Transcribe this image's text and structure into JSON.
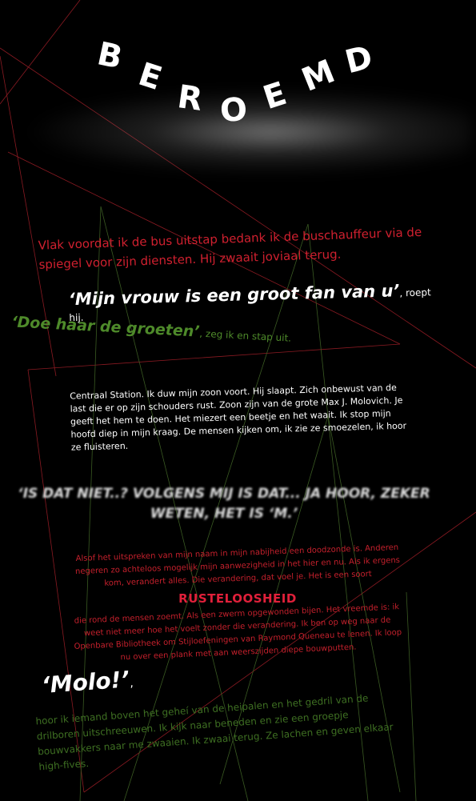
{
  "title": {
    "letters": [
      "B",
      "E",
      "R",
      "O",
      "E",
      "M",
      "D"
    ]
  },
  "paragraph_1": "Vlak voordat ik de bus uitstap bedank ik de buschauffeur via de spiegel voor zijn diensten. Hij zwaait joviaal terug.",
  "quote_1": {
    "text": "‘Mijn vrouw is een groot fan van u’",
    "suffix": ", roept hij."
  },
  "quote_2": {
    "text": "‘Doe haar de groeten’",
    "suffix": ", zeg ik en stap uit."
  },
  "paragraph_2": "Centraal Station. Ik duw mijn zoon voort. Hij slaapt. Zich onbewust van de last die er op zijn schouders rust. Zoon zijn van de grote Max J. Molovich. Je geeft het hem te doen. Het miezert een beetje en het waait. Ik stop mijn hoofd diep in mijn kraag. De mensen kijken om, ik zie ze smoezelen, ik hoor ze fluisteren.",
  "shout": "‘IS DAT NIET..? VOLGENS MIJ IS DAT... JA HOOR, ZEKER WETEN, HET IS ‘M.’",
  "paragraph_3a": "Alsof het uitspreken van mijn naam in mijn nabijheid een doodzonde is. Anderen negeren zo achteloos mogelijk mijn aanwezigheid in het hier en nu. Als ik ergens kom, verandert alles. Die verandering, dat voel je. Het is een soort",
  "emphasis_word": "RUSTELOOSHEID",
  "paragraph_3b": "die rond de mensen zoemt. Als een zwerm opgewonden bijen. Het vreemde is: ik weet niet meer hoe het voelt zonder die verandering. Ik ben op weg naar de Openbare Bibliotheek om Stijloefeningen van Raymond Queneau te lenen. Ik loop nu over een plank met aan weerszijden diepe bouwputten.",
  "quote_3": {
    "text": "‘Molo!’",
    "suffix": ","
  },
  "paragraph_4": "hoor ik iemand boven het geheí van de heipalen en het gedril van de drilboren uitschreeuwen. Ik kijk naar beneden en zie een groepje bouwvakkers naar me zwaaien. Ik zwaai terug. Ze lachen en geven elkaar high-fives.",
  "colors": {
    "background": "#000000",
    "red_text": "#d0202f",
    "green_text": "#4e8a2a",
    "white_text": "#ffffff"
  }
}
